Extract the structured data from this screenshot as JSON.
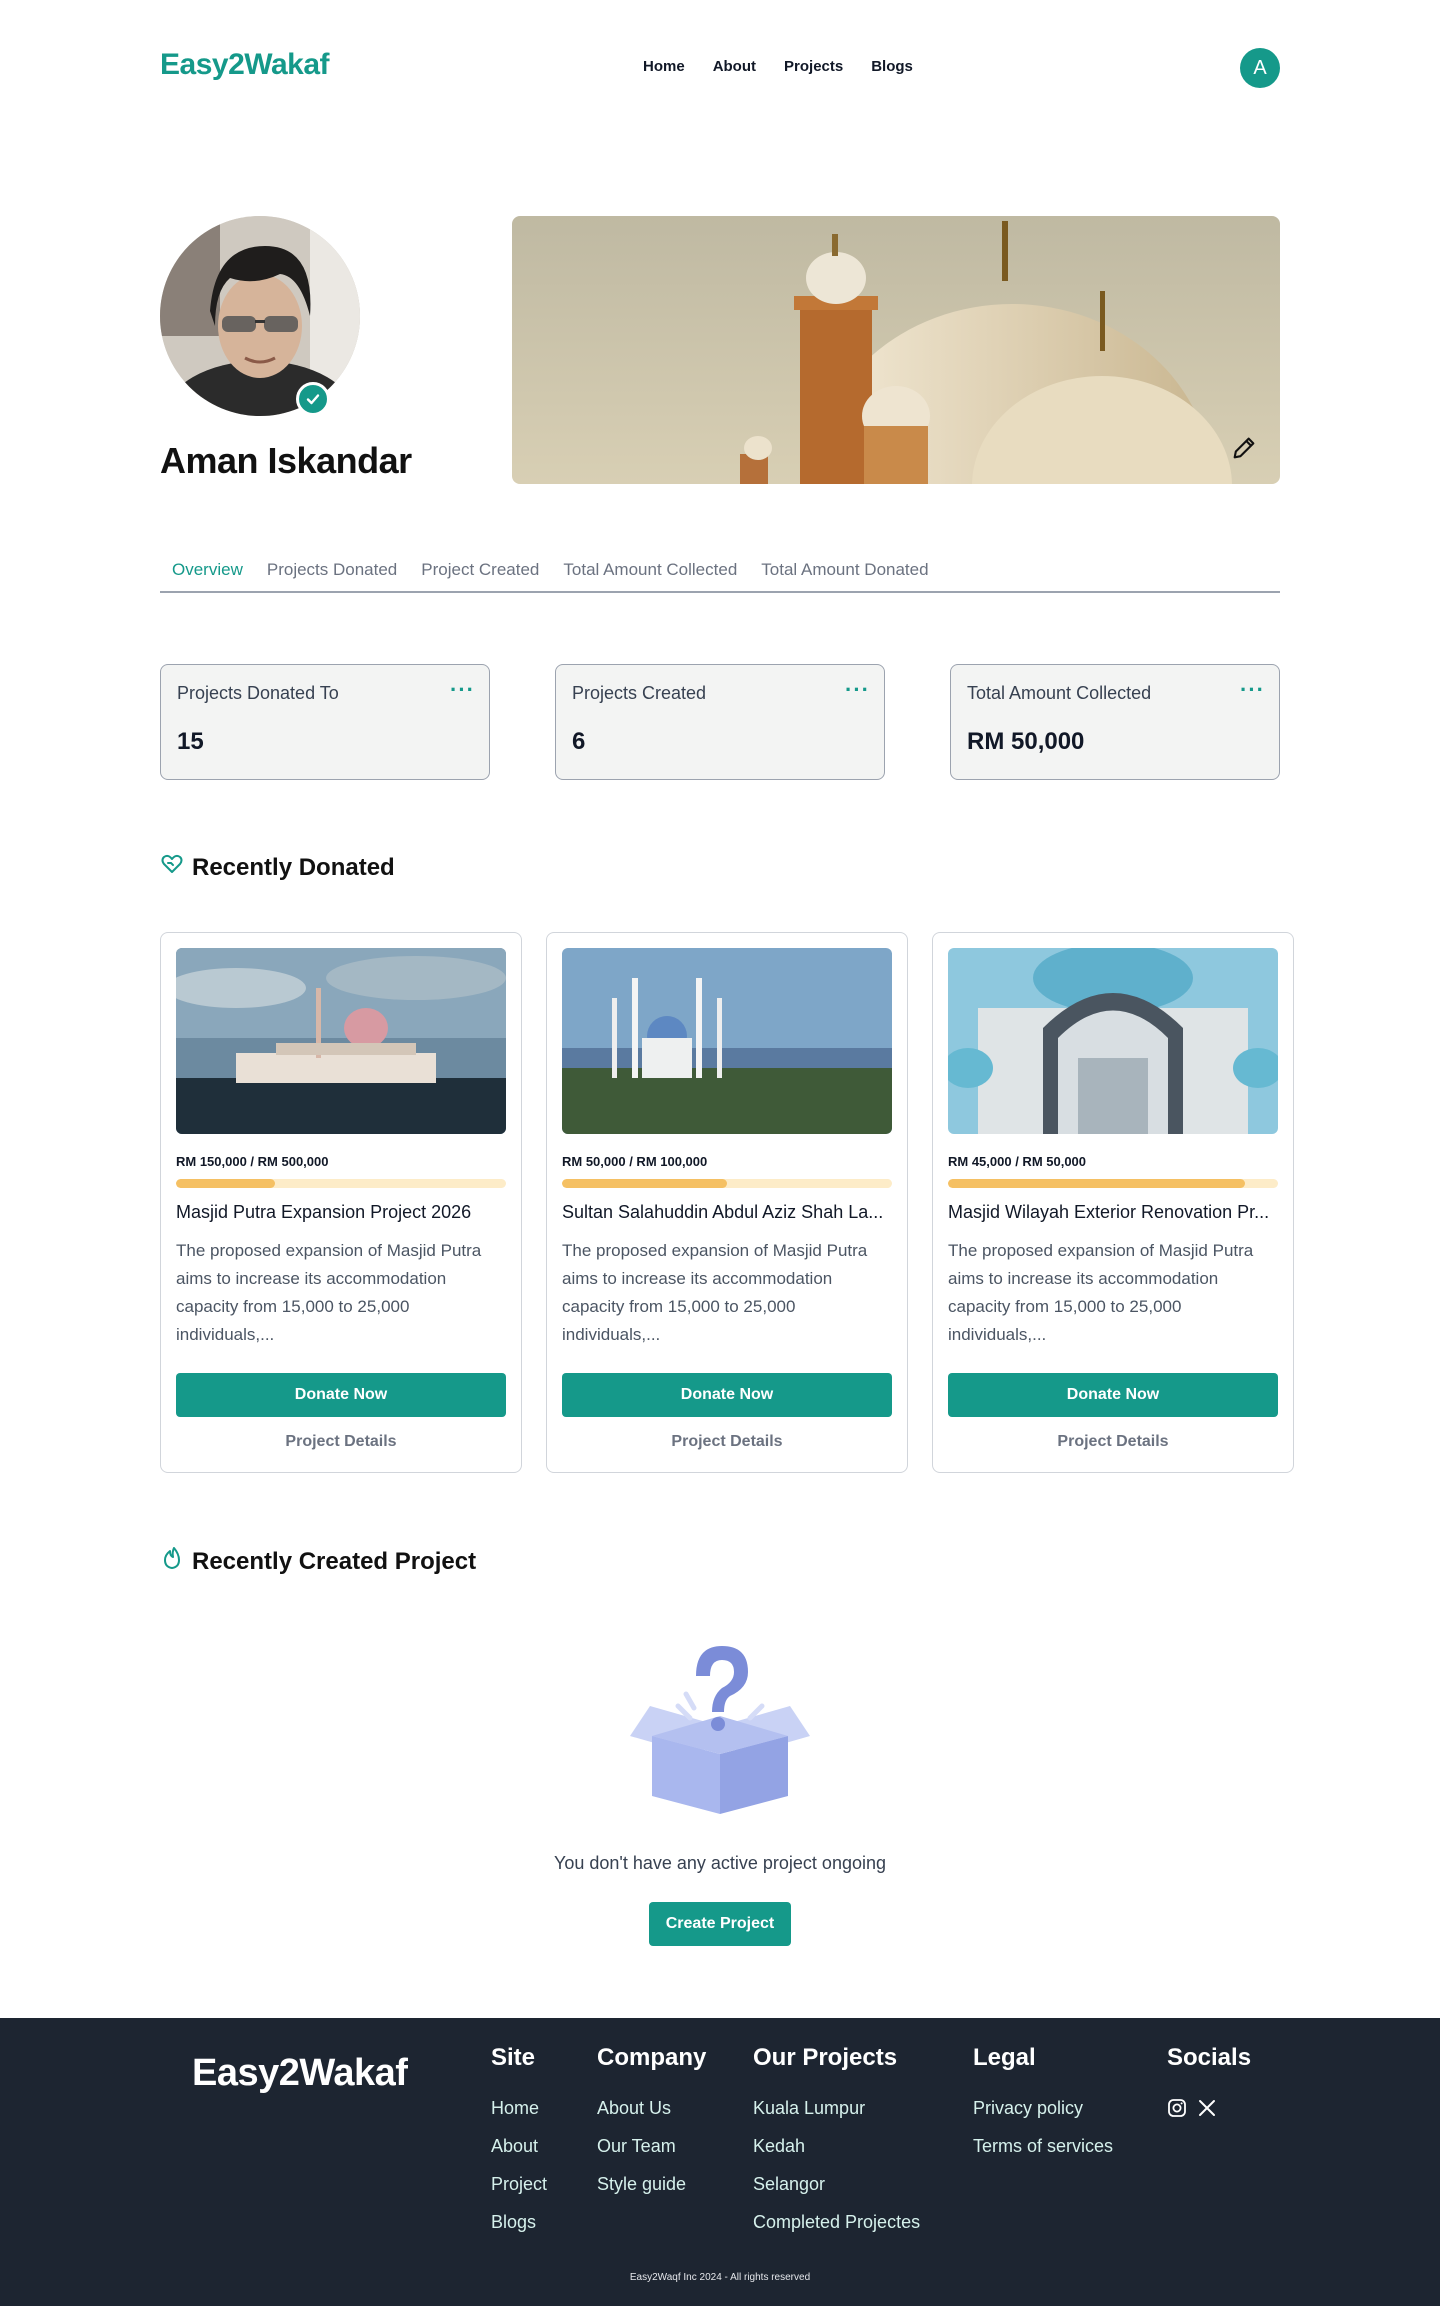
{
  "header": {
    "logo": "Easy2Wakaf",
    "nav": [
      "Home",
      "About",
      "Projects",
      "Blogs"
    ],
    "avatar_initial": "A"
  },
  "profile": {
    "name": "Aman Iskandar"
  },
  "tabs": [
    {
      "label": "Overview",
      "active": true
    },
    {
      "label": "Projects Donated",
      "active": false
    },
    {
      "label": "Project Created",
      "active": false
    },
    {
      "label": "Total Amount Collected",
      "active": false
    },
    {
      "label": "Total Amount Donated",
      "active": false
    }
  ],
  "stats": [
    {
      "label": "Projects Donated To",
      "value": "15"
    },
    {
      "label": "Projects Created",
      "value": "6"
    },
    {
      "label": "Total Amount Collected",
      "value": "RM 50,000"
    }
  ],
  "recently_donated": {
    "title": "Recently Donated",
    "cards": [
      {
        "amount": "RM 150,000 / RM 500,000",
        "progress": 0.3,
        "title": "Masjid Putra Expansion Project 2026",
        "desc": "The proposed expansion of Masjid Putra aims to increase its accommodation capacity from 15,000 to 25,000 individuals,...",
        "donate_label": "Donate Now",
        "details_label": "Project Details"
      },
      {
        "amount": "RM 50,000 / RM 100,000",
        "progress": 0.5,
        "title": "Sultan Salahuddin Abdul Aziz Shah La...",
        "desc": "The proposed expansion of Masjid Putra aims to increase its accommodation capacity from 15,000 to 25,000 individuals,...",
        "donate_label": "Donate Now",
        "details_label": "Project Details"
      },
      {
        "amount": "RM 45,000 / RM 50,000",
        "progress": 0.9,
        "title": "Masjid Wilayah Exterior Renovation Pr...",
        "desc": "The proposed expansion of Masjid Putra aims to increase its accommodation capacity from 15,000 to 25,000 individuals,...",
        "donate_label": "Donate Now",
        "details_label": "Project Details"
      }
    ]
  },
  "recently_created": {
    "title": "Recently Created Project",
    "empty_text": "You don't have any active project ongoing",
    "create_label": "Create Project"
  },
  "footer": {
    "logo": "Easy2Wakaf",
    "site": {
      "title": "Site",
      "links": [
        "Home",
        "About",
        "Project",
        "Blogs"
      ]
    },
    "company": {
      "title": "Company",
      "links": [
        "About Us",
        "Our Team",
        "Style guide"
      ]
    },
    "projects": {
      "title": "Our Projects",
      "links": [
        "Kuala Lumpur",
        "Kedah",
        "Selangor",
        "Completed Projectes"
      ]
    },
    "legal": {
      "title": "Legal",
      "links": [
        "Privacy policy",
        "Terms of services"
      ]
    },
    "socials": {
      "title": "Socials",
      "icons": [
        "instagram-icon",
        "x-icon"
      ]
    },
    "copyright": "Easy2Waqf Inc 2024 - All rights reserved"
  },
  "colors": {
    "brand": "#15998a",
    "progress": "#f5c063",
    "footer_bg": "#1d2531"
  }
}
